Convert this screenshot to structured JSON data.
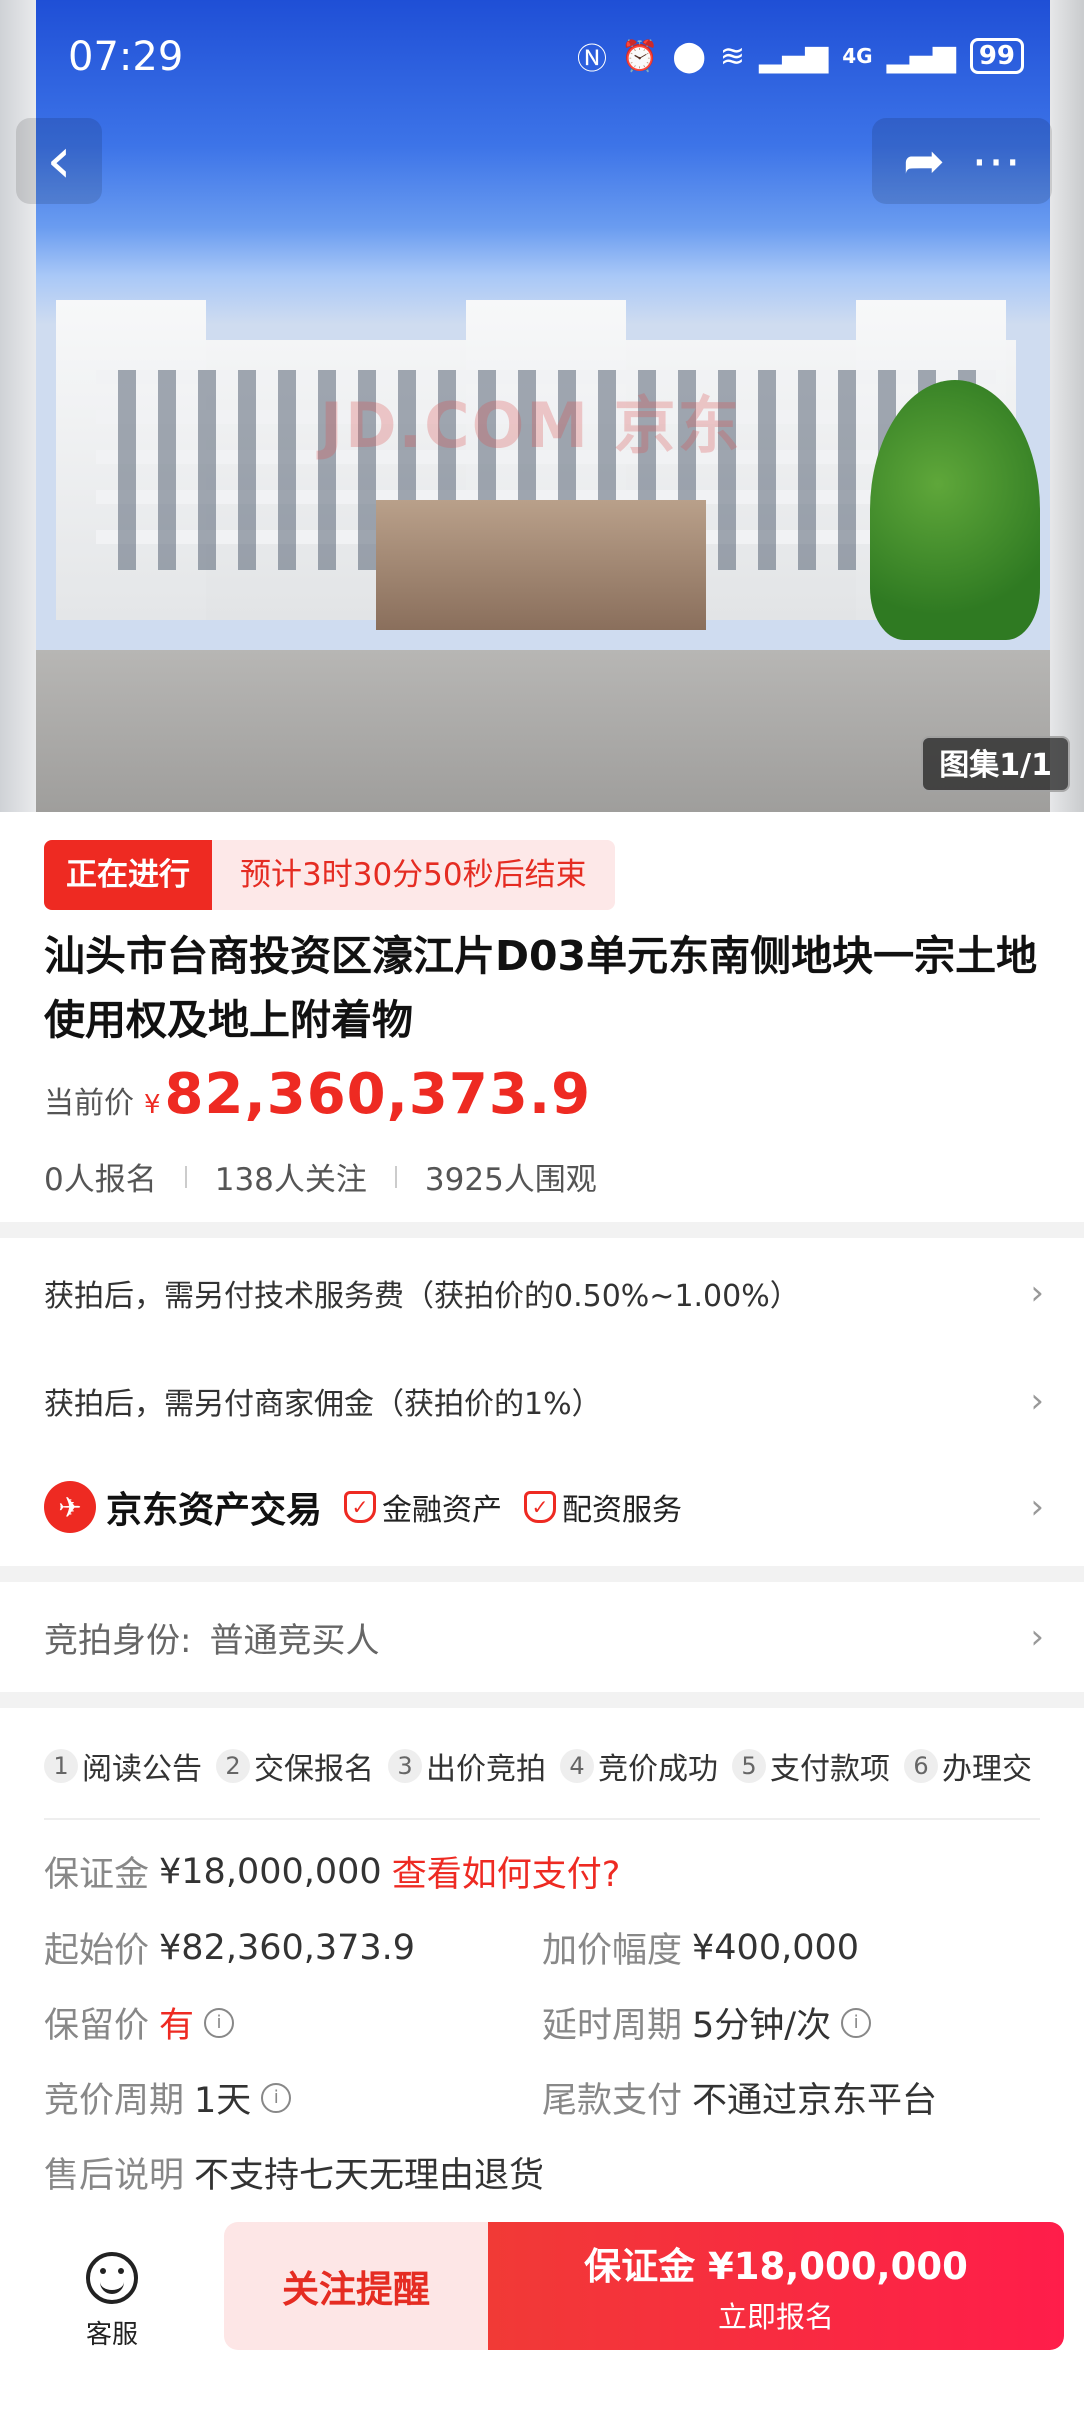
{
  "status_bar": {
    "time": "07:29",
    "battery": "99",
    "network": "4G"
  },
  "gallery": {
    "counter": "图集1/1",
    "watermark": "JD.COM 京东"
  },
  "auction": {
    "status": "正在进行",
    "countdown": "预计3时30分50秒后结束",
    "title": "汕头市台商投资区濠江片D03单元东南侧地块一宗土地使用权及地上附着物",
    "price_label": "当前价",
    "currency": "¥",
    "price": "82,360,373.9",
    "registrations": "0人报名",
    "followers": "138人关注",
    "viewers": "3925人围观"
  },
  "fees": {
    "service_fee": "获拍后，需另付技术服务费（获拍价的0.50%~1.00%）",
    "commission": "获拍后，需另付商家佣金（获拍价的1%）"
  },
  "platform": {
    "name": "京东资产交易",
    "tags": [
      "金融资产",
      "配资服务"
    ]
  },
  "identity": {
    "label": "竞拍身份:",
    "value": "普通竞买人"
  },
  "steps": [
    {
      "num": "1",
      "label": "阅读公告"
    },
    {
      "num": "2",
      "label": "交保报名"
    },
    {
      "num": "3",
      "label": "出价竞拍"
    },
    {
      "num": "4",
      "label": "竞价成功"
    },
    {
      "num": "5",
      "label": "支付款项"
    },
    {
      "num": "6",
      "label": "办理交"
    }
  ],
  "details": {
    "deposit_label": "保证金",
    "deposit_value": "¥18,000,000",
    "deposit_link": "查看如何支付?",
    "start_label": "起始价",
    "start_value": "¥82,360,373.9",
    "increment_label": "加价幅度",
    "increment_value": "¥400,000",
    "reserve_label": "保留价",
    "reserve_value": "有",
    "delay_label": "延时周期",
    "delay_value": "5分钟/次",
    "cycle_label": "竞价周期",
    "cycle_value": "1天",
    "final_label": "尾款支付",
    "final_value": "不通过京东平台",
    "aftersale_label": "售后说明",
    "aftersale_value": "不支持七天无理由退货"
  },
  "bottom_bar": {
    "service_label": "客服",
    "follow_label": "关注提醒",
    "signup_main": "保证金 ¥18,000,000",
    "signup_sub": "立即报名"
  },
  "colors": {
    "accent": "#ee2a22",
    "badge_bg": "#fde8e8"
  }
}
